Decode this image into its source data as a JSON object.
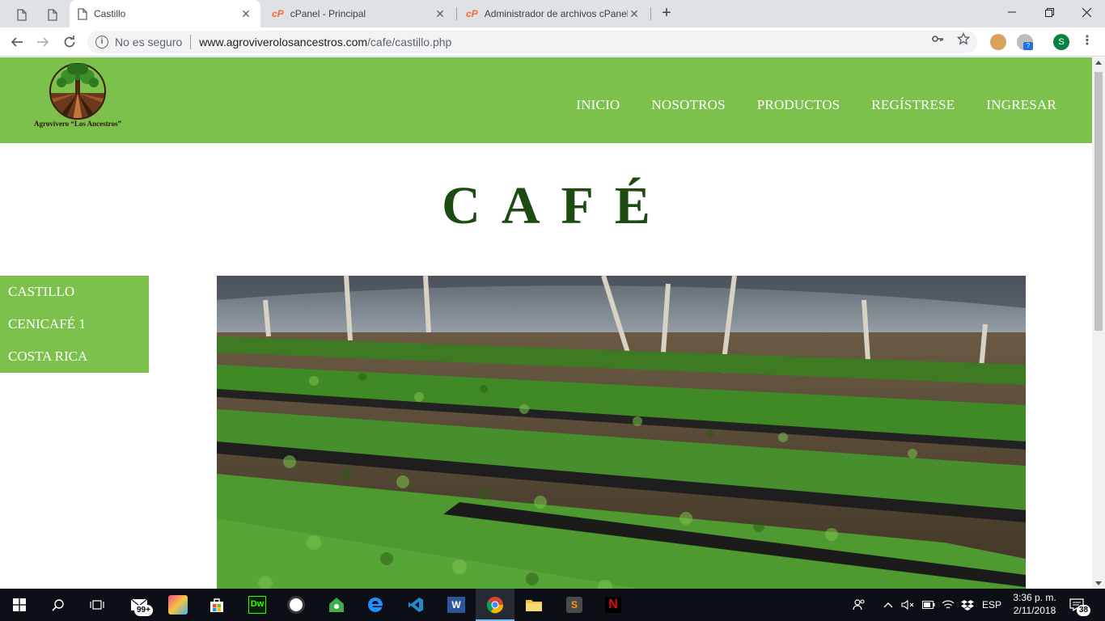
{
  "browser": {
    "tabs": [
      {
        "title": "Castillo",
        "active": true
      },
      {
        "title": "cPanel - Principal",
        "active": false
      },
      {
        "title": "Administrador de archivos cPanel",
        "active": false
      }
    ],
    "address": {
      "security_label": "No es seguro",
      "host": "www.agroviverolosancestros.com",
      "path": "/cafe/castillo.php"
    },
    "profile_initial": "S"
  },
  "site": {
    "logo_text": "Agrovivero “Los Ancestros”",
    "nav": [
      "INICIO",
      "NOSOTROS",
      "PRODUCTOS",
      "REGÍSTRESE",
      "INGRESAR"
    ],
    "page_title": "CAFÉ",
    "side_menu": [
      "CASTILLO",
      "CENICAFÉ 1",
      "COSTA RICA"
    ]
  },
  "taskbar": {
    "mail_badge": "99+",
    "lang": "ESP",
    "time": "3:36 p. m.",
    "date": "2/11/2018",
    "notifications": "38"
  },
  "colors": {
    "header_green": "#7bc14c",
    "title_green": "#1d4b12",
    "taskbar": "#0c1016"
  }
}
